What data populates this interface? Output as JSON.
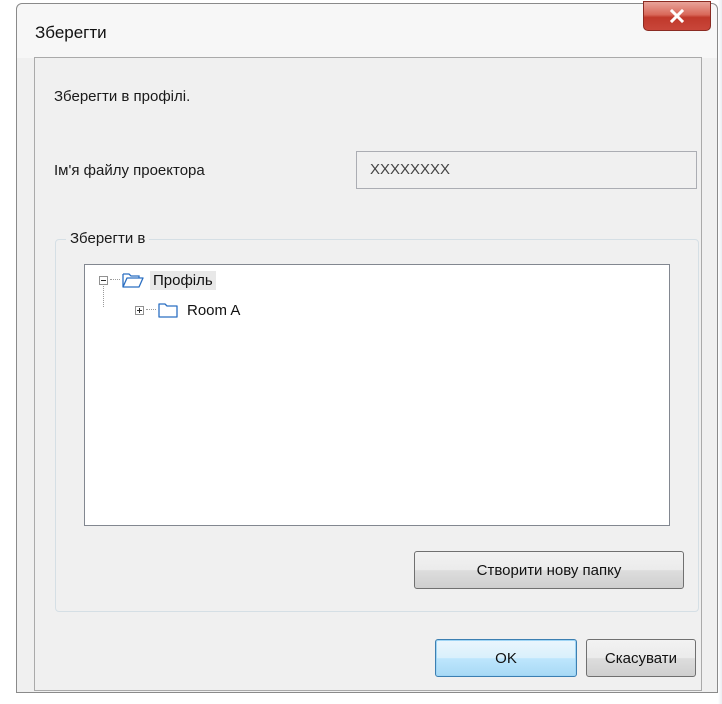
{
  "window": {
    "title": "Зберегти",
    "close_icon": "close-icon"
  },
  "form": {
    "instruction": "Зберегти в профілі.",
    "file_label": "Ім'я файлу проектора",
    "file_value": "XXXXXXXX"
  },
  "group": {
    "legend": "Зберегти в"
  },
  "tree": {
    "nodes": [
      {
        "label": "Профіль",
        "expanded": true,
        "selected": true,
        "icon": "folder-open-icon"
      },
      {
        "label": "Room A",
        "expanded": false,
        "selected": false,
        "icon": "folder-icon"
      }
    ]
  },
  "buttons": {
    "new_folder": "Створити нову папку",
    "ok": "OK",
    "cancel": "Скасувати"
  },
  "colors": {
    "close_button": "#c9463a",
    "ok_button_border": "#3c7fb1"
  }
}
